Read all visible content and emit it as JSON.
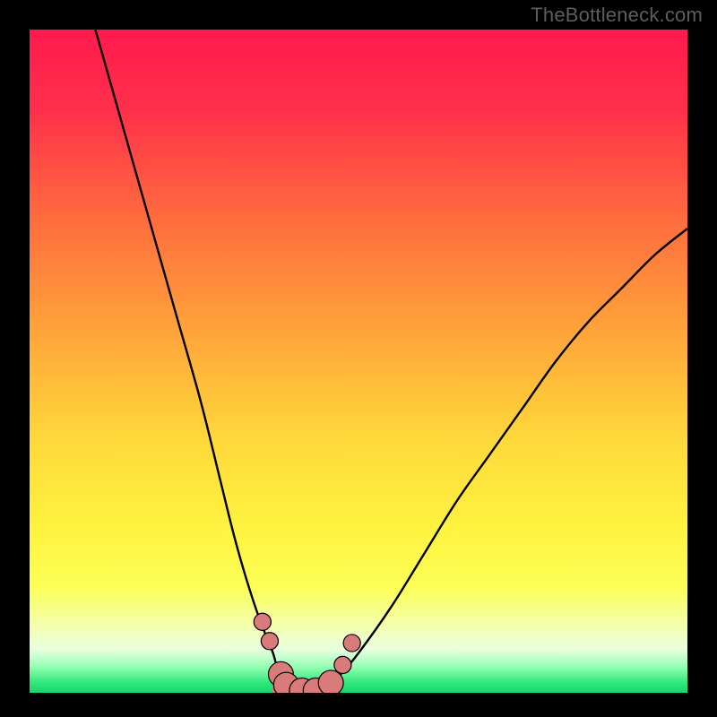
{
  "watermark": "TheBottleneck.com",
  "gradient_stops": [
    {
      "offset": 0.0,
      "color": "#ff1a4d"
    },
    {
      "offset": 0.12,
      "color": "#ff2f4b"
    },
    {
      "offset": 0.28,
      "color": "#ff6a3e"
    },
    {
      "offset": 0.45,
      "color": "#ffa23a"
    },
    {
      "offset": 0.62,
      "color": "#ffd93a"
    },
    {
      "offset": 0.75,
      "color": "#fff23f"
    },
    {
      "offset": 0.84,
      "color": "#fcff55"
    },
    {
      "offset": 0.9,
      "color": "#f3ffb0"
    },
    {
      "offset": 0.935,
      "color": "#e8ffe0"
    },
    {
      "offset": 0.96,
      "color": "#98ffb5"
    },
    {
      "offset": 0.985,
      "color": "#30e87b"
    },
    {
      "offset": 1.0,
      "color": "#17d46f"
    }
  ],
  "marker_color": "#d97b7b",
  "marker_stroke": "#000000",
  "curve_color": "#000000",
  "chart_data": {
    "type": "line",
    "title": "",
    "xlabel": "",
    "ylabel": "",
    "x_range": [
      0,
      100
    ],
    "y_range": [
      0,
      100
    ],
    "series": [
      {
        "name": "bottleneck-curve",
        "x": [
          10,
          14,
          18,
          22,
          26,
          29,
          31,
          33,
          35,
          37,
          38,
          39.5,
          42,
          44.5,
          47,
          50,
          55,
          60,
          65,
          70,
          75,
          80,
          85,
          90,
          95,
          100
        ],
        "y": [
          100,
          86,
          72,
          58,
          44,
          32,
          24,
          17,
          11,
          6,
          2.5,
          0.8,
          0.3,
          0.8,
          2.5,
          6,
          13,
          21,
          29,
          36,
          43,
          50,
          56,
          61,
          66,
          70
        ]
      }
    ],
    "markers": [
      {
        "x": 35.4,
        "y": 10.7,
        "r": 1.3
      },
      {
        "x": 36.5,
        "y": 7.8,
        "r": 1.3
      },
      {
        "x": 38.2,
        "y": 2.8,
        "r": 1.9
      },
      {
        "x": 39.0,
        "y": 1.2,
        "r": 1.9
      },
      {
        "x": 41.4,
        "y": 0.35,
        "r": 1.9
      },
      {
        "x": 43.5,
        "y": 0.35,
        "r": 1.9
      },
      {
        "x": 45.8,
        "y": 1.5,
        "r": 1.9
      },
      {
        "x": 47.6,
        "y": 4.2,
        "r": 1.3
      },
      {
        "x": 49.0,
        "y": 7.5,
        "r": 1.3
      }
    ],
    "valley_band": {
      "x0": 38.2,
      "x1": 45.8,
      "y": 0.35,
      "thickness": 2.7
    }
  }
}
